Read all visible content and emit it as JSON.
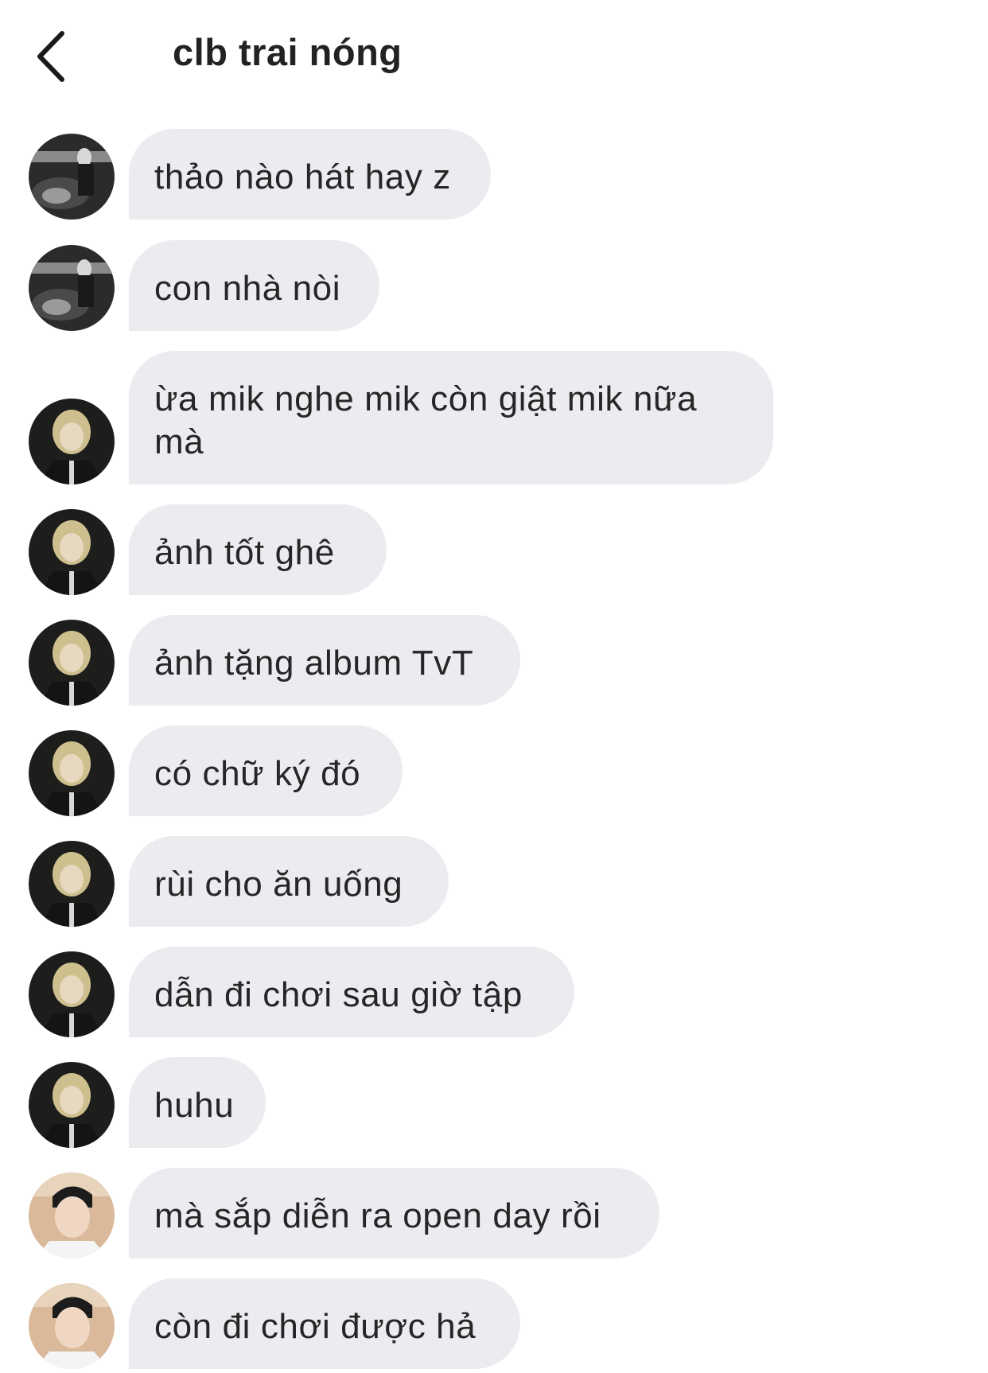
{
  "header": {
    "title": "clb trai nóng",
    "back_icon": "chevron-left-icon"
  },
  "messages": [
    {
      "sender": "avatar-a",
      "text": "thảo nào hát hay z"
    },
    {
      "sender": "avatar-a",
      "text": "con nhà nòi"
    },
    {
      "sender": "avatar-b",
      "text": "ừa mik nghe mik còn giật mik nữa mà"
    },
    {
      "sender": "avatar-b",
      "text": "ảnh tốt ghê"
    },
    {
      "sender": "avatar-b",
      "text": "ảnh tặng album TvT"
    },
    {
      "sender": "avatar-b",
      "text": "có chữ ký đó"
    },
    {
      "sender": "avatar-b",
      "text": "rùi cho ăn uống"
    },
    {
      "sender": "avatar-b",
      "text": "dẫn đi chơi sau giờ tập"
    },
    {
      "sender": "avatar-b",
      "text": "huhu"
    },
    {
      "sender": "avatar-c",
      "text": "mà sắp diễn ra open day rồi"
    },
    {
      "sender": "avatar-c",
      "text": "còn đi chơi được hả"
    }
  ],
  "colors": {
    "bubble": "#ebecf0",
    "text": "#262626",
    "background": "#ffffff"
  }
}
